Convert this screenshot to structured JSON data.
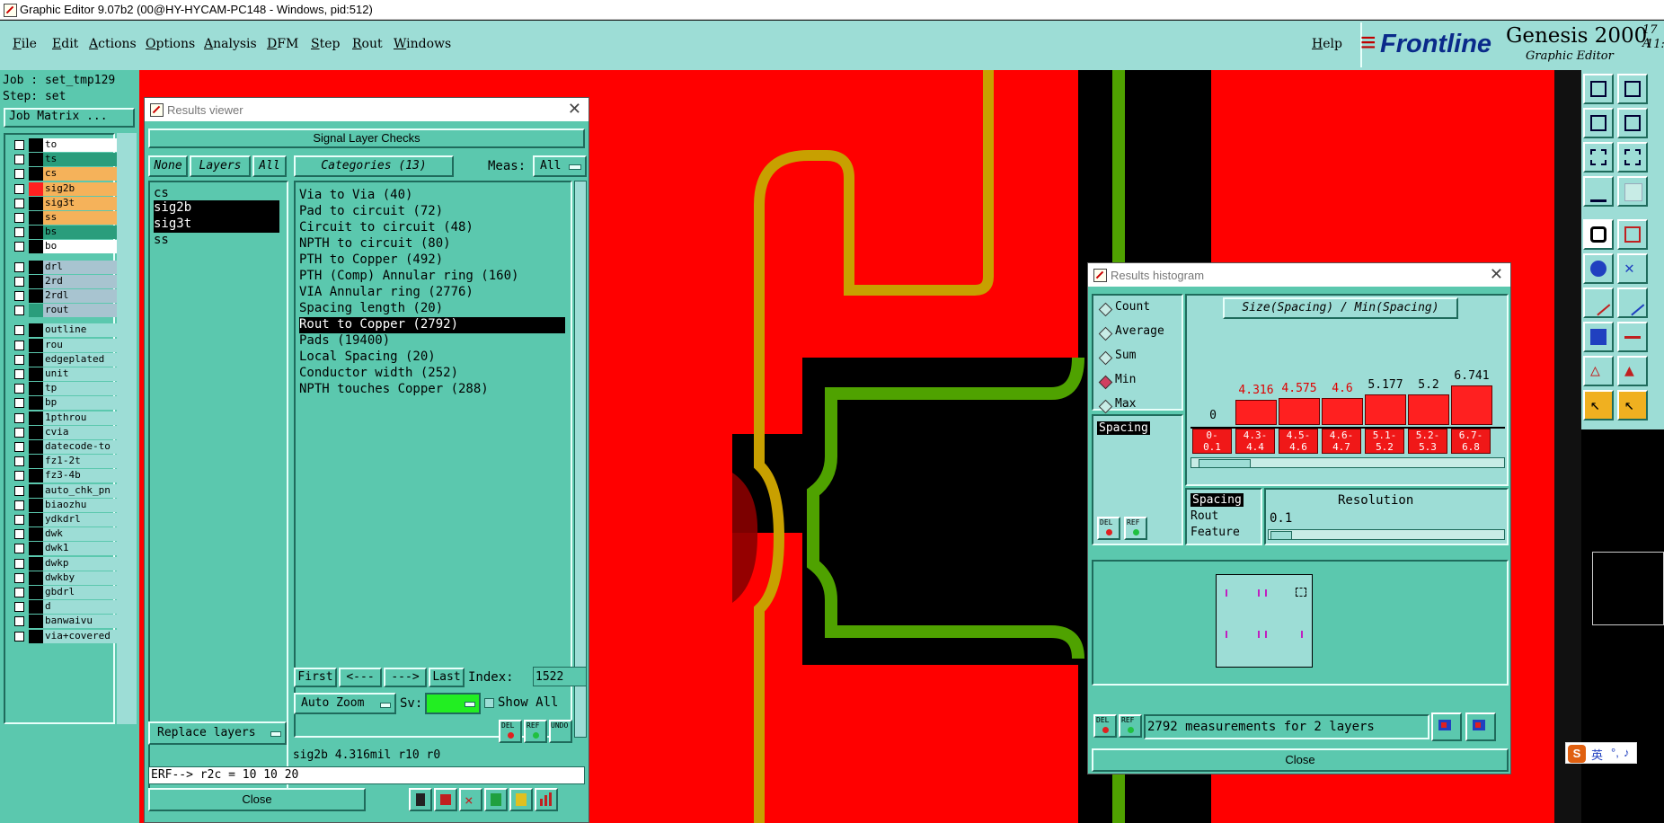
{
  "window_title": "Graphic Editor 9.07b2 (00@HY-HYCAM-PC148 - Windows, pid:512)",
  "menu": [
    "File",
    "Edit",
    "Actions",
    "Options",
    "Analysis",
    "DFM",
    "Step",
    "Rout",
    "Windows"
  ],
  "help": "Help",
  "logo": {
    "brand": "Frontline",
    "product": "Genesis 2000",
    "sub": "Graphic Editor",
    "date_fragment": "17 A",
    "time_fragment": "11:"
  },
  "job_panel": {
    "job": "Job : set_tmp129",
    "step": "Step: set",
    "job_matrix": "Job Matrix ...",
    "layers": [
      {
        "name": "to",
        "color": "#ffffff",
        "swatch": "#000000"
      },
      {
        "name": "ts",
        "color": "#2a9d7c",
        "swatch": "#000000"
      },
      {
        "name": "cs",
        "color": "#f5b25a",
        "swatch": "#000000"
      },
      {
        "name": "sig2b",
        "color": "#f5b25a",
        "swatch": "#ff2020"
      },
      {
        "name": "sig3t",
        "color": "#f5b25a",
        "swatch": "#000000"
      },
      {
        "name": "ss",
        "color": "#f5b25a",
        "swatch": "#000000"
      },
      {
        "name": "bs",
        "color": "#2a9d7c",
        "swatch": "#000000"
      },
      {
        "name": "bo",
        "color": "#ffffff",
        "swatch": "#000000"
      },
      {
        "name": "drl",
        "color": "#a8c4d0",
        "swatch": "#000000"
      },
      {
        "name": "2rd",
        "color": "#a8c4d0",
        "swatch": "#000000"
      },
      {
        "name": "2rdl",
        "color": "#a8c4d0",
        "swatch": "#000000"
      },
      {
        "name": "rout",
        "color": "#a8c4d0",
        "swatch": "#2a9d7c"
      },
      {
        "name": "outline",
        "color": "#9dddd6",
        "swatch": "#000000"
      },
      {
        "name": "rou",
        "color": "#9dddd6",
        "swatch": "#000000"
      },
      {
        "name": "edgeplated",
        "color": "#9dddd6",
        "swatch": "#000000"
      },
      {
        "name": "unit",
        "color": "#9dddd6",
        "swatch": "#000000"
      },
      {
        "name": "tp",
        "color": "#9dddd6",
        "swatch": "#000000"
      },
      {
        "name": "bp",
        "color": "#9dddd6",
        "swatch": "#000000"
      },
      {
        "name": "1pthrou",
        "color": "#9dddd6",
        "swatch": "#000000"
      },
      {
        "name": "cvia",
        "color": "#9dddd6",
        "swatch": "#000000"
      },
      {
        "name": "datecode-to",
        "color": "#9dddd6",
        "swatch": "#000000"
      },
      {
        "name": "fz1-2t",
        "color": "#9dddd6",
        "swatch": "#000000"
      },
      {
        "name": "fz3-4b",
        "color": "#9dddd6",
        "swatch": "#000000"
      },
      {
        "name": "auto_chk_pn",
        "color": "#9dddd6",
        "swatch": "#000000"
      },
      {
        "name": "biaozhu",
        "color": "#9dddd6",
        "swatch": "#000000"
      },
      {
        "name": "ydkdrl",
        "color": "#9dddd6",
        "swatch": "#000000"
      },
      {
        "name": "dwk",
        "color": "#9dddd6",
        "swatch": "#000000"
      },
      {
        "name": "dwk1",
        "color": "#9dddd6",
        "swatch": "#000000"
      },
      {
        "name": "dwkp",
        "color": "#9dddd6",
        "swatch": "#000000"
      },
      {
        "name": "dwkby",
        "color": "#9dddd6",
        "swatch": "#000000"
      },
      {
        "name": "gbdrl",
        "color": "#9dddd6",
        "swatch": "#000000"
      },
      {
        "name": "d",
        "color": "#9dddd6",
        "swatch": "#000000"
      },
      {
        "name": "banwaivu",
        "color": "#9dddd6",
        "swatch": "#000000"
      },
      {
        "name": "via+covered",
        "color": "#9dddd6",
        "swatch": "#000000"
      }
    ]
  },
  "results_viewer": {
    "title": "Results viewer",
    "heading": "Signal Layer Checks",
    "none_btn": "None",
    "layers_btn": "Layers",
    "all_btn": "All",
    "categories_btn": "Categories (13)",
    "meas_label": "Meas:",
    "meas_value": "All",
    "layers": [
      "cs",
      "sig2b",
      "sig3t",
      "ss"
    ],
    "selected_layers": [
      "sig2b",
      "sig3t"
    ],
    "categories": [
      "Via to Via (40)",
      "Pad to circuit (72)",
      "Circuit to circuit (48)",
      "NPTH to circuit (80)",
      "PTH to Copper (492)",
      "PTH (Comp) Annular ring (160)",
      "VIA Annular ring (2776)",
      "Spacing length (20)",
      "Rout to Copper (2792)",
      "Pads (19400)",
      "Local Spacing (20)",
      "Conductor width (252)",
      "NPTH touches Copper (288)"
    ],
    "selected_category": "Rout to Copper (2792)",
    "first_btn": "First",
    "prev_btn": "<---",
    "next_btn": "--->",
    "last_btn": "Last",
    "index_label": "Index:",
    "index_value": "1522",
    "auto_zoom": "Auto Zoom",
    "sv_label": "Sv:",
    "show_all": "Show All",
    "replace_layers": "Replace layers",
    "status": "sig2b 4.316mil  r10  r0",
    "erf": "ERF--> r2c = 10 10 20",
    "close": "Close",
    "del_label": "DEL",
    "ref_label": "REF",
    "undo_label": "UNDO"
  },
  "histogram": {
    "title": "Results histogram",
    "chart_title": "Size(Spacing) / Min(Spacing)",
    "modes": [
      "Count",
      "Average",
      "Sum",
      "Min",
      "Max"
    ],
    "selected_mode": "Min",
    "spacing_item": "Spacing",
    "resolution_list": [
      "Spacing",
      "Rout",
      "Feature"
    ],
    "resolution_label": "Resolution",
    "resolution_value": "0.1",
    "measurements": "2792 measurements for 2 layers",
    "close": "Close",
    "del_label": "DEL",
    "ref_label": "REF"
  },
  "chart_data": {
    "type": "bar",
    "title": "Size(Spacing) / Min(Spacing)",
    "categories": [
      "0-0.1",
      "4.3-4.4",
      "4.5-4.6",
      "4.6-4.7",
      "5.1-5.2",
      "5.2-5.3",
      "6.7-6.8"
    ],
    "category_labels_top": [
      "0-",
      "4.3-",
      "4.5-",
      "4.6-",
      "5.1-",
      "5.2-",
      "6.7-"
    ],
    "category_labels_bottom": [
      "0.1",
      "4.4",
      "4.6",
      "4.7",
      "5.2",
      "5.3",
      "6.8"
    ],
    "values": [
      0,
      4.316,
      4.575,
      4.6,
      5.177,
      5.2,
      6.741
    ],
    "value_labels": [
      "0",
      "4.316",
      "4.575",
      "4.6",
      "5.177",
      "5.2",
      "6.741"
    ],
    "ylim": [
      0,
      6.741
    ],
    "colors": {
      "bar": "#ff2020",
      "label_red": "#e00000",
      "label_black": "#000000"
    }
  },
  "colors": {
    "panel_teal": "#5bc8ae",
    "panel_light": "#9dddd6",
    "canvas_red": "#ff0000",
    "trace_orange": "#c8a000",
    "trace_green": "#4fa200"
  },
  "ime": {
    "label": "英"
  }
}
